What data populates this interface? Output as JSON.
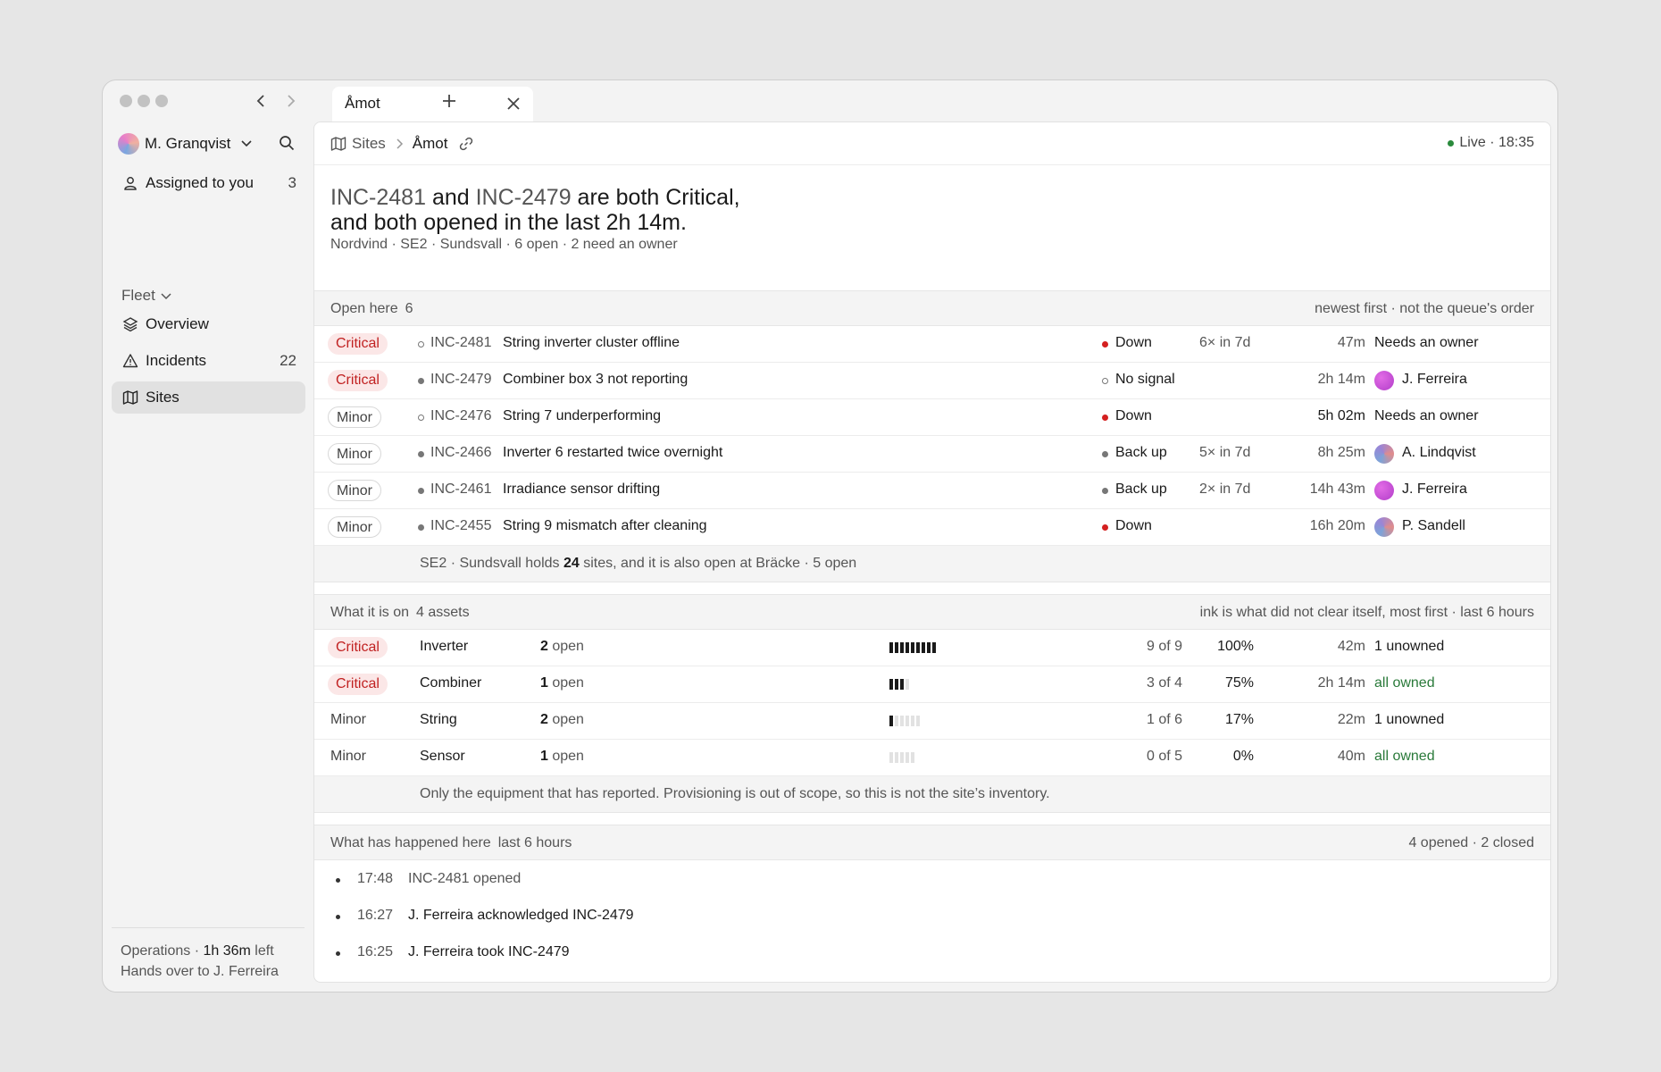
{
  "window": {
    "tab_label": "Åmot"
  },
  "sidebar": {
    "user_name": "M. Granqvist",
    "assigned": {
      "label": "Assigned to you",
      "count": "3"
    },
    "group_label": "Fleet",
    "items": [
      {
        "label": "Overview",
        "count": ""
      },
      {
        "label": "Incidents",
        "count": "22"
      },
      {
        "label": "Sites",
        "count": ""
      }
    ],
    "footer": {
      "line1_prefix": "Operations · ",
      "line1_time": "1h 36m",
      "line1_suffix": " left",
      "line2": "Hands over to J. Ferreira"
    }
  },
  "topbar": {
    "crumb_root": "Sites",
    "crumb_current": "Åmot",
    "live": "Live · 18:35"
  },
  "headline": {
    "inc_a": "INC-2481",
    "and": " and ",
    "inc_b": "INC-2479",
    "rest1": " are both Critical,",
    "line2": "and both opened in the last 2h 14m.",
    "subline": "Nordvind  ·  SE2 · Sundsvall  ·  6 open  ·  2 need an owner"
  },
  "open_section": {
    "label": "Open here",
    "count": "6",
    "sort_note": "newest first · not the queue's order",
    "rows": [
      {
        "severity": "Critical",
        "id": "INC-2481",
        "title": "String inverter cluster offline",
        "status": "Down",
        "freq": "6× in 7d",
        "age": "47m",
        "owner": "Needs an owner"
      },
      {
        "severity": "Critical",
        "id": "INC-2479",
        "title": "Combiner box 3 not reporting",
        "status": "No signal",
        "freq": "",
        "age": "2h 14m",
        "owner": "J. Ferreira"
      },
      {
        "severity": "Minor",
        "id": "INC-2476",
        "title": "String 7 underperforming",
        "status": "Down",
        "freq": "",
        "age": "5h 02m",
        "owner": "Needs an owner"
      },
      {
        "severity": "Minor",
        "id": "INC-2466",
        "title": "Inverter 6 restarted twice overnight",
        "status": "Back up",
        "freq": "5× in 7d",
        "age": "8h 25m",
        "owner": "A. Lindqvist"
      },
      {
        "severity": "Minor",
        "id": "INC-2461",
        "title": "Irradiance sensor drifting",
        "status": "Back up",
        "freq": "2× in 7d",
        "age": "14h 43m",
        "owner": "J. Ferreira"
      },
      {
        "severity": "Minor",
        "id": "INC-2455",
        "title": "String 9 mismatch after cleaning",
        "status": "Down",
        "freq": "",
        "age": "16h 20m",
        "owner": "P. Sandell"
      }
    ],
    "note_prefix": "SE2 · Sundsvall holds ",
    "note_count": "24",
    "note_suffix": " sites, and it is also open at Bräcke · 5 open"
  },
  "assets_section": {
    "label": "What it is on",
    "count": "4 assets",
    "sort_note": "ink is what did not clear itself, most first · last 6 hours",
    "rows": [
      {
        "severity": "Critical",
        "asset": "Inverter",
        "open_n": "2",
        "open_l": " open",
        "fraction": "9 of 9",
        "ink": 9,
        "total": 9,
        "pct": "100%",
        "age": "42m",
        "owners": "1 unowned"
      },
      {
        "severity": "Critical",
        "asset": "Combiner",
        "open_n": "1",
        "open_l": " open",
        "fraction": "3 of 4",
        "ink": 3,
        "total": 4,
        "pct": "75%",
        "age": "2h 14m",
        "owners": "all owned"
      },
      {
        "severity": "Minor",
        "asset": "String",
        "open_n": "2",
        "open_l": " open",
        "fraction": "1 of 6",
        "ink": 1,
        "total": 6,
        "pct": "17%",
        "age": "22m",
        "owners": "1 unowned"
      },
      {
        "severity": "Minor",
        "asset": "Sensor",
        "open_n": "1",
        "open_l": " open",
        "fraction": "0 of 5",
        "ink": 0,
        "total": 5,
        "pct": "0%",
        "age": "40m",
        "owners": "all owned"
      }
    ],
    "note": "Only the equipment that has reported. Provisioning is out of scope, so this is not the site’s inventory."
  },
  "history_section": {
    "label": "What has happened here",
    "window": "last 6 hours",
    "summary": "4 opened · 2 closed",
    "events": [
      {
        "time": "17:48",
        "text": "INC-2481 opened"
      },
      {
        "time": "16:27",
        "text": "J. Ferreira acknowledged INC-2479"
      },
      {
        "time": "16:25",
        "text": "J. Ferreira took INC-2479"
      }
    ]
  },
  "colors": {
    "critical": "#c12222",
    "critical_bg": "#fbe7e7",
    "down": "#d42020",
    "live": "#2a8a3c",
    "owned": "#2a7a3a"
  }
}
